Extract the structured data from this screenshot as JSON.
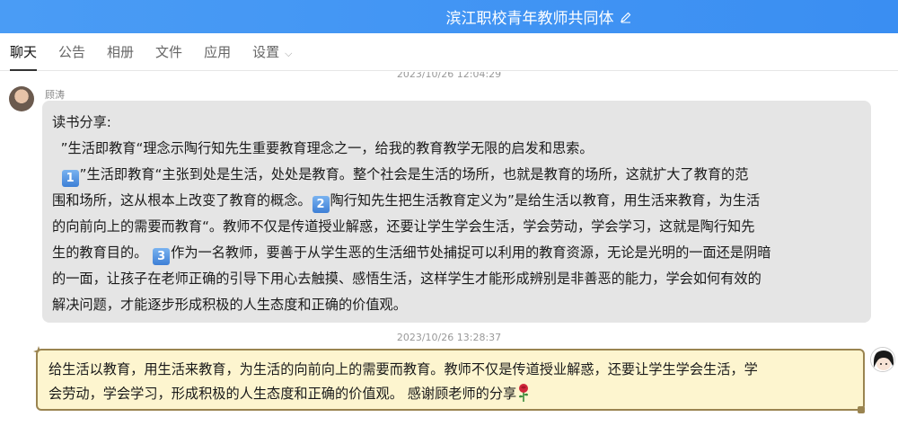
{
  "window": {
    "title": "滨江职校青年教师共同体"
  },
  "tabs": [
    {
      "label": "聊天"
    },
    {
      "label": "公告"
    },
    {
      "label": "相册"
    },
    {
      "label": "文件"
    },
    {
      "label": "应用"
    },
    {
      "label": "设置"
    }
  ],
  "messages": {
    "top_timestamp": "2023/10/26 12:04:29",
    "first": {
      "sender": "顾涛",
      "lines": [
        "读书分享:",
        "  ”生活即教育“理念示陶行知先生重要教育理念之一，给我的教育教学无限的启发和思索。",
        "”生活即教育“主张到处是生活，处处是教育。整个社会是生活的场所，也就是教育的场所，这就扩大了教育的范",
        "围和场所，这从根本上改变了教育的概念。",
        "陶行知先生把生活教育定义为”是给生活以教育，用生活来教育，为生活",
        "的向前向上的需要而教育“。教师不仅是传道授业解惑，还要让学生学会生活，学会劳动，学会学习，这就是陶行知先",
        "生的教育目的。",
        "作为一名教师，要善于从学生恶的生活细节处捕捉可以利用的教育资源，无论是光明的一面还是阴暗",
        "的一面，让孩子在老师正确的引导下用心去触摸、感悟生活，这样学生才能形成辨别是非善恶的能力，学会如何有效的",
        "解决问题，才能逐步形成积极的人生态度和正确的价值观。"
      ],
      "num1": "1",
      "num2": "2",
      "num3": "3"
    },
    "mid_timestamp": "2023/10/26 13:28:37",
    "second": {
      "line1": "给生活以教育，用生活来教育，为生活的向前向上的需要而教育。教师不仅是传道授业解惑，还要让学生学会生活，学",
      "line2": "会劳动，学会学习，形成积极的人生态度和正确的价值观。 感谢顾老师的分享"
    }
  },
  "colors": {
    "header": "#3a8ef2",
    "bubble_gray": "#e5e5e5",
    "bubble_gold": "#fdf5cf",
    "gold_border": "#9a8450"
  },
  "icons": {
    "edit": "pencil-icon",
    "settings_dropdown": "chevron-down-icon",
    "rose": "rose-icon"
  }
}
